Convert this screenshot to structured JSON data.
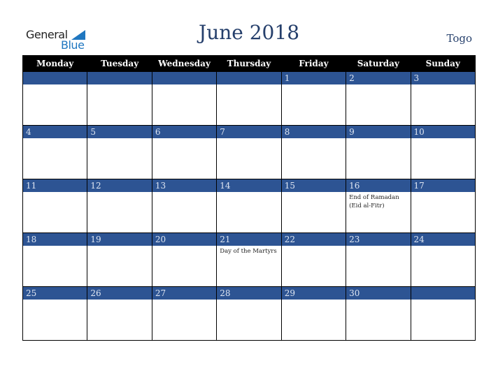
{
  "logo": {
    "line1": "General",
    "line2": "Blue"
  },
  "header": {
    "title": "June 2018",
    "country": "Togo"
  },
  "colors": {
    "header_bg": "#000000",
    "band_bg": "#2d5493",
    "title_color": "#253f6b",
    "logo_blue": "#1f77c0"
  },
  "weekdays": [
    "Monday",
    "Tuesday",
    "Wednesday",
    "Thursday",
    "Friday",
    "Saturday",
    "Sunday"
  ],
  "weeks": [
    [
      {
        "day": "",
        "event": ""
      },
      {
        "day": "",
        "event": ""
      },
      {
        "day": "",
        "event": ""
      },
      {
        "day": "",
        "event": ""
      },
      {
        "day": "1",
        "event": ""
      },
      {
        "day": "2",
        "event": ""
      },
      {
        "day": "3",
        "event": ""
      }
    ],
    [
      {
        "day": "4",
        "event": ""
      },
      {
        "day": "5",
        "event": ""
      },
      {
        "day": "6",
        "event": ""
      },
      {
        "day": "7",
        "event": ""
      },
      {
        "day": "8",
        "event": ""
      },
      {
        "day": "9",
        "event": ""
      },
      {
        "day": "10",
        "event": ""
      }
    ],
    [
      {
        "day": "11",
        "event": ""
      },
      {
        "day": "12",
        "event": ""
      },
      {
        "day": "13",
        "event": ""
      },
      {
        "day": "14",
        "event": ""
      },
      {
        "day": "15",
        "event": ""
      },
      {
        "day": "16",
        "event": "End of Ramadan (Eid al-Fitr)"
      },
      {
        "day": "17",
        "event": ""
      }
    ],
    [
      {
        "day": "18",
        "event": ""
      },
      {
        "day": "19",
        "event": ""
      },
      {
        "day": "20",
        "event": ""
      },
      {
        "day": "21",
        "event": "Day of the Martyrs"
      },
      {
        "day": "22",
        "event": ""
      },
      {
        "day": "23",
        "event": ""
      },
      {
        "day": "24",
        "event": ""
      }
    ],
    [
      {
        "day": "25",
        "event": ""
      },
      {
        "day": "26",
        "event": ""
      },
      {
        "day": "27",
        "event": ""
      },
      {
        "day": "28",
        "event": ""
      },
      {
        "day": "29",
        "event": ""
      },
      {
        "day": "30",
        "event": ""
      },
      {
        "day": "",
        "event": ""
      }
    ]
  ]
}
